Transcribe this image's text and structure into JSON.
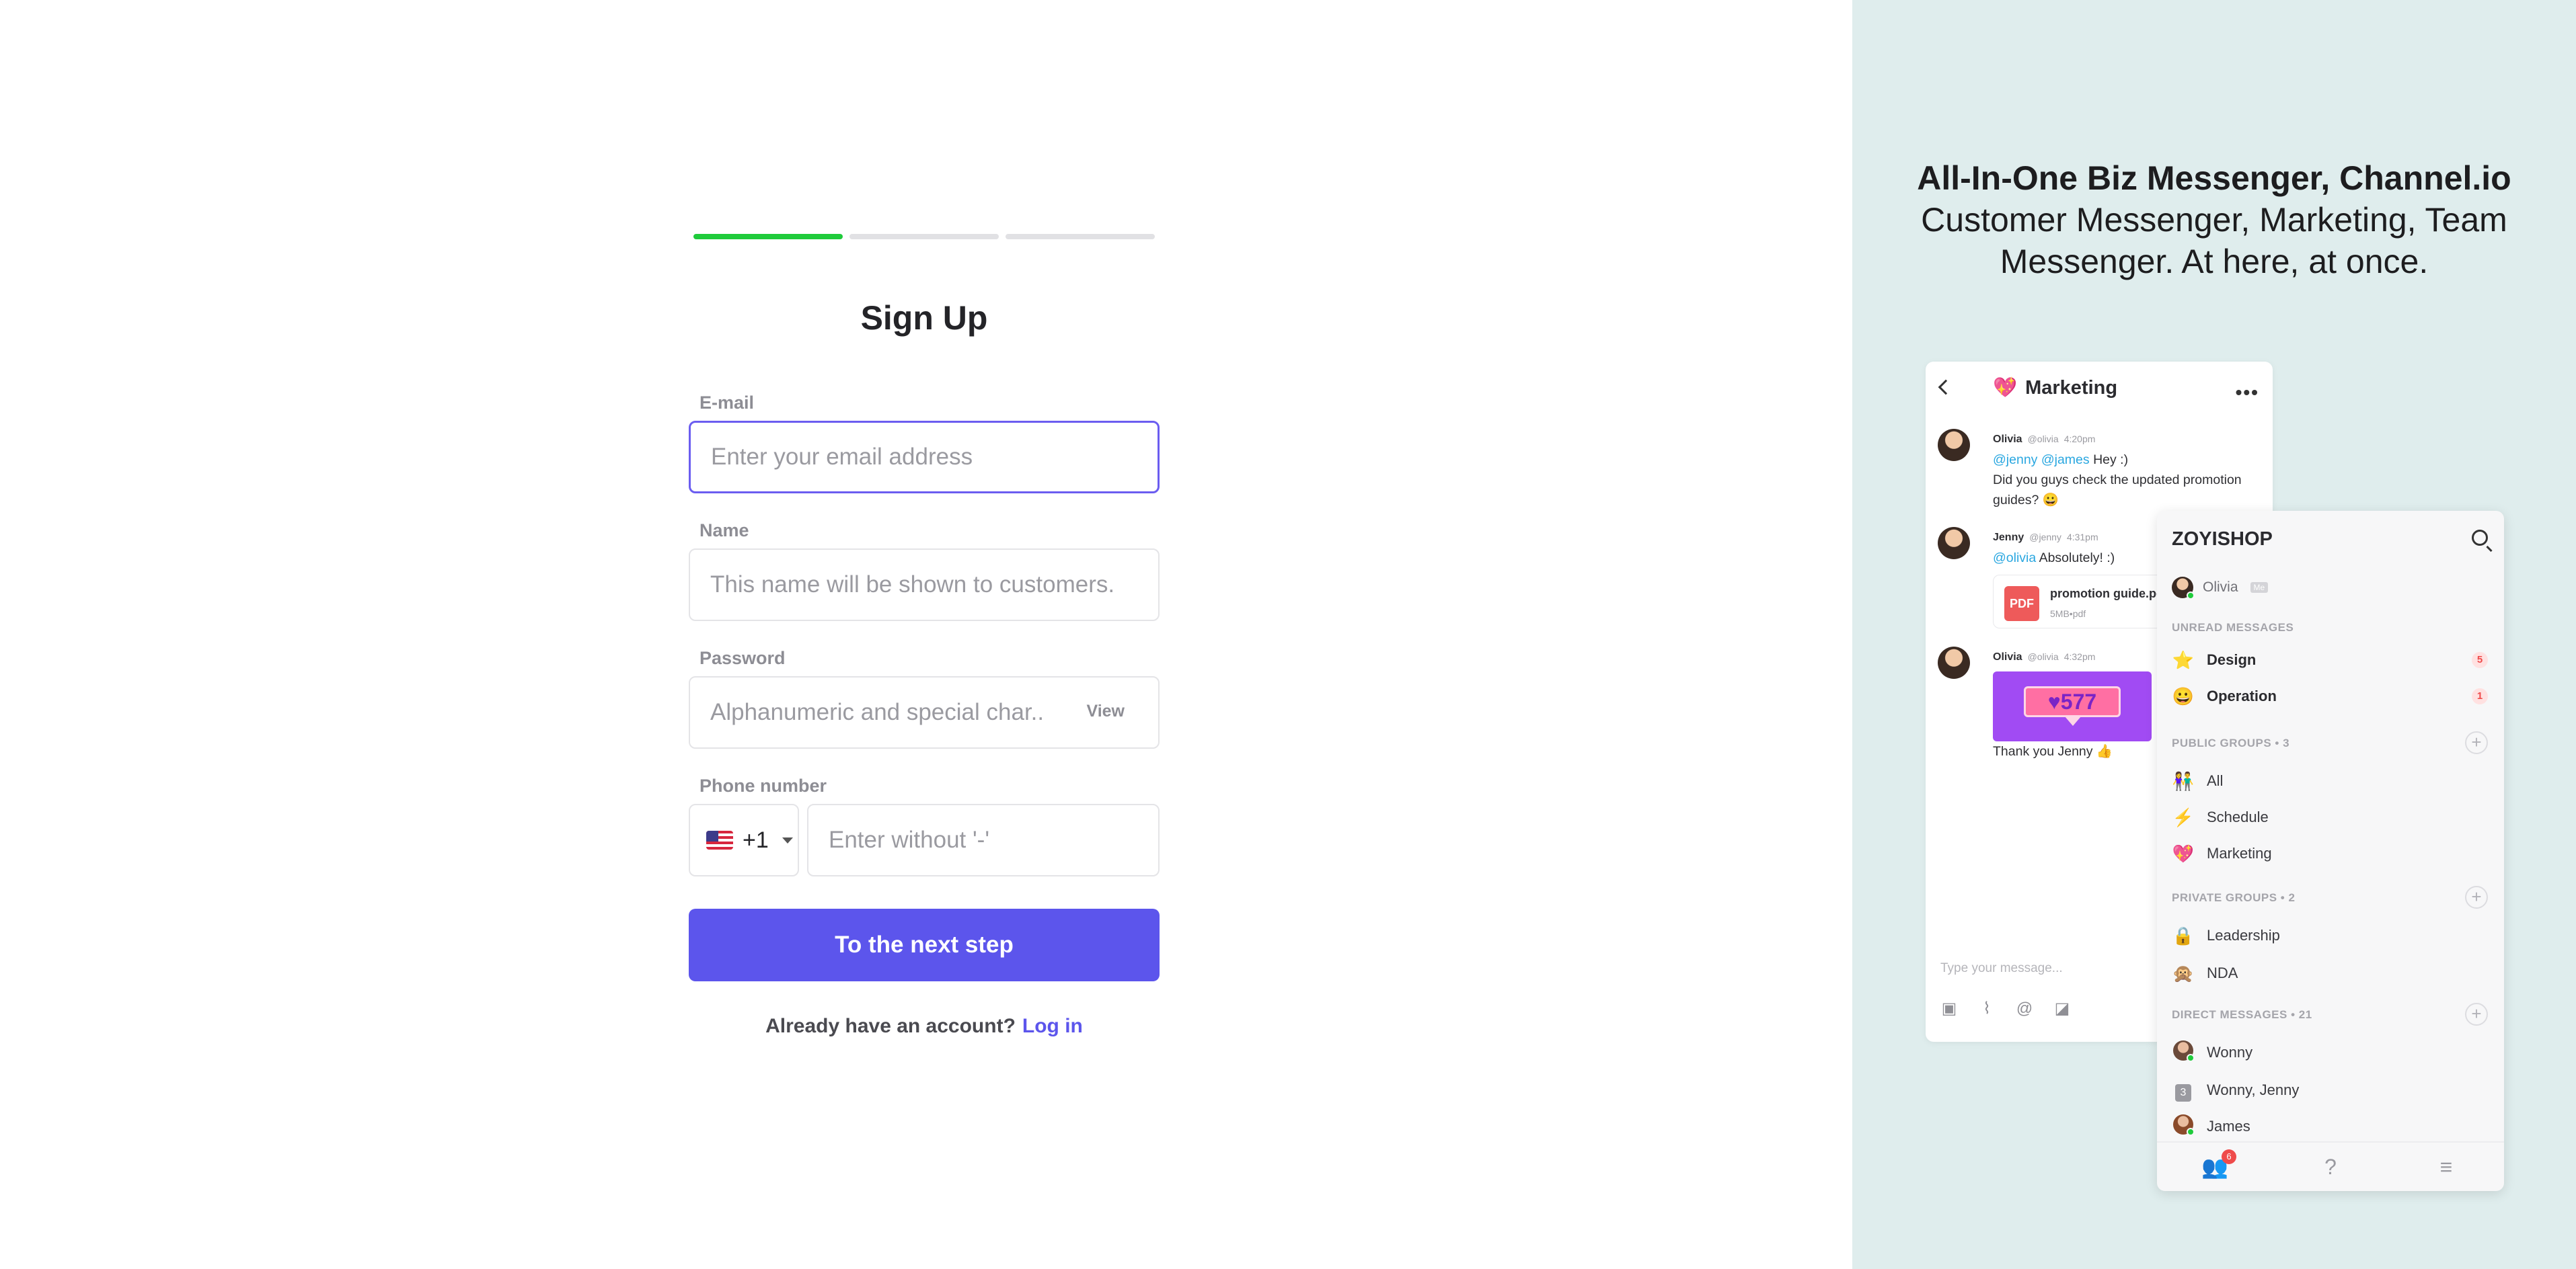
{
  "signup": {
    "progress_steps": [
      {
        "done": true
      },
      {
        "done": false
      },
      {
        "done": false
      }
    ],
    "title": "Sign Up",
    "email": {
      "label": "E-mail",
      "placeholder": "Enter your email address"
    },
    "name": {
      "label": "Name",
      "placeholder": "This name will be shown to customers."
    },
    "password": {
      "label": "Password",
      "placeholder": "Alphanumeric and special char...",
      "view_label": "View"
    },
    "phone": {
      "label": "Phone number",
      "country_code": "+1",
      "country_flag": "us-flag-icon",
      "placeholder": "Enter without '-'"
    },
    "next_button": "To the next step",
    "account_prompt": "Already have an account?",
    "login_link": "Log in",
    "colors": {
      "accent": "#5c55ec",
      "progress": "#1fcb3b",
      "focus_border": "#6b5df0"
    }
  },
  "promo": {
    "headline_bold": "All-In-One Biz Messenger, Channel.io",
    "headline_line2": "Customer Messenger, Marketing, Team",
    "headline_line3": "Messenger. At here, at once.",
    "background": "#dfeded"
  },
  "chat": {
    "title": "Marketing",
    "title_icon": "heart-icon",
    "messages": [
      {
        "author": "Olivia",
        "handle": "@olivia",
        "time": "4:20pm",
        "mentions": "@jenny @james",
        "text1": " Hey :)",
        "text2": "Did you guys check the updated promotion guides? 😀"
      },
      {
        "author": "Jenny",
        "handle": "@jenny",
        "time": "4:31pm",
        "mention": "@olivia",
        "text": " Absolutely! :)",
        "file_type": "PDF",
        "file_name": "promotion guide.pdf",
        "file_size": "5MB•pdf"
      },
      {
        "author": "Olivia",
        "handle": "@olivia",
        "time": "4:32pm",
        "promo_label": "♥577",
        "text": "Thank you Jenny 👍"
      }
    ],
    "input_placeholder": "Type your message...",
    "tools": [
      "image-icon",
      "attach-icon",
      "mention-icon",
      "sticker-icon"
    ]
  },
  "sidebar": {
    "workspace": "ZOYISHOP",
    "user": "Olivia",
    "user_tag": "Me",
    "unread_header": "UNREAD MESSAGES",
    "unread": [
      {
        "icon": "⭐",
        "label": "Design",
        "count": "5"
      },
      {
        "icon": "😀",
        "label": "Operation",
        "count": "1"
      }
    ],
    "public_header": "PUBLIC GROUPS • 3",
    "public": [
      {
        "icon": "👫",
        "label": "All"
      },
      {
        "icon": "⚡",
        "label": "Schedule"
      },
      {
        "icon": "💖",
        "label": "Marketing"
      }
    ],
    "private_header": "PRIVATE GROUPS • 2",
    "private": [
      {
        "icon": "🔒",
        "label": "Leadership"
      },
      {
        "icon": "🙊",
        "label": "NDA"
      }
    ],
    "direct_header": "DIRECT MESSAGES • 21",
    "direct": [
      {
        "label": "Wonny"
      },
      {
        "label": "Wonny, Jenny",
        "count_icon": "3"
      },
      {
        "label": "James"
      }
    ],
    "tab_badge": "6"
  }
}
